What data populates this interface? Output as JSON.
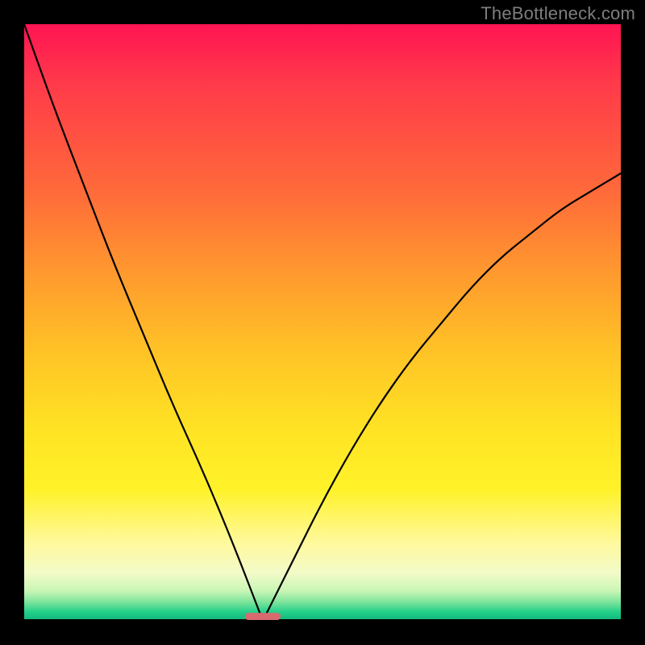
{
  "attribution": "TheBottleneck.com",
  "chart_data": {
    "type": "line",
    "title": "",
    "xlabel": "",
    "ylabel": "",
    "xlim": [
      0,
      1
    ],
    "ylim": [
      0,
      1
    ],
    "grid": false,
    "legend": false,
    "x_min_point": 0.4,
    "series": [
      {
        "name": "curve",
        "x": [
          0.0,
          0.05,
          0.1,
          0.15,
          0.2,
          0.25,
          0.3,
          0.35,
          0.4,
          0.45,
          0.5,
          0.55,
          0.6,
          0.65,
          0.7,
          0.75,
          0.8,
          0.85,
          0.9,
          0.95,
          1.0
        ],
        "y": [
          1.0,
          0.86,
          0.73,
          0.6,
          0.48,
          0.36,
          0.25,
          0.13,
          0.0,
          0.1,
          0.2,
          0.29,
          0.37,
          0.44,
          0.5,
          0.56,
          0.61,
          0.65,
          0.69,
          0.72,
          0.75
        ]
      }
    ],
    "marker": {
      "name": "min-pill",
      "x_center": 0.4,
      "y": 0.0,
      "width": 0.06,
      "height": 0.012,
      "color": "#d86a6f"
    },
    "background_gradient_stops": [
      {
        "pos": 0.0,
        "color": "#ff1453"
      },
      {
        "pos": 0.28,
        "color": "#ff6a3a"
      },
      {
        "pos": 0.55,
        "color": "#ffc326"
      },
      {
        "pos": 0.78,
        "color": "#fff229"
      },
      {
        "pos": 0.92,
        "color": "#f2fbc8"
      },
      {
        "pos": 1.0,
        "color": "#0fb37a"
      }
    ]
  }
}
